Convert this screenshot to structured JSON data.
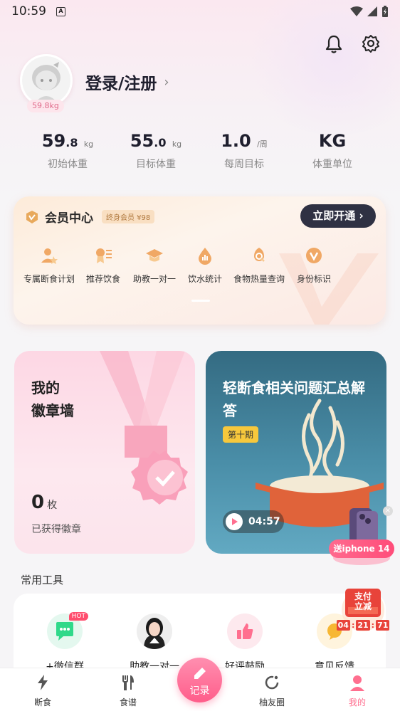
{
  "status": {
    "time": "10:59"
  },
  "profile": {
    "login_label": "登录/注册",
    "weight_tag": "59.8kg"
  },
  "stats": [
    {
      "int": "59",
      "dec": ".8",
      "unit": "kg",
      "label": "初始体重"
    },
    {
      "int": "55",
      "dec": ".0",
      "unit": "kg",
      "label": "目标体重"
    },
    {
      "int": "1.0",
      "dec": "",
      "unit": "/周",
      "label": "每周目标"
    },
    {
      "int": "KG",
      "dec": "",
      "unit": "",
      "label": "体重单位"
    }
  ],
  "member": {
    "title": "会员中心",
    "tag": "终身会员 ¥98",
    "button": "立即开通",
    "items": [
      "专属断食计划",
      "推荐饮食",
      "助教一对一",
      "饮水统计",
      "食物热量查询",
      "身份标识"
    ]
  },
  "badge_card": {
    "title_line1": "我的",
    "title_line2": "徽章墙",
    "count": "0",
    "count_unit": "枚",
    "subtitle": "已获得徽章"
  },
  "qa_card": {
    "title": "轻断食相关问题汇总解答",
    "episode": "第十期",
    "duration": "04:57"
  },
  "promo": {
    "label": "送iphone 14"
  },
  "pay_widget": {
    "line1": "支付",
    "line2": "立减",
    "countdown": [
      "04",
      "21",
      "71"
    ]
  },
  "tools": {
    "title": "常用工具",
    "items": [
      {
        "label": "+微信群",
        "hot": "HOT"
      },
      {
        "label": "助教一对一"
      },
      {
        "label": "好评鼓励"
      },
      {
        "label": "意见反馈"
      }
    ]
  },
  "nav": {
    "items": [
      "断食",
      "食谱",
      "记录",
      "柚友圈",
      "我的"
    ],
    "active": "我的"
  },
  "colors": {
    "accent": "#ff6f8f",
    "dark_button": "#2f3143",
    "member_tag": "#b0793f"
  }
}
